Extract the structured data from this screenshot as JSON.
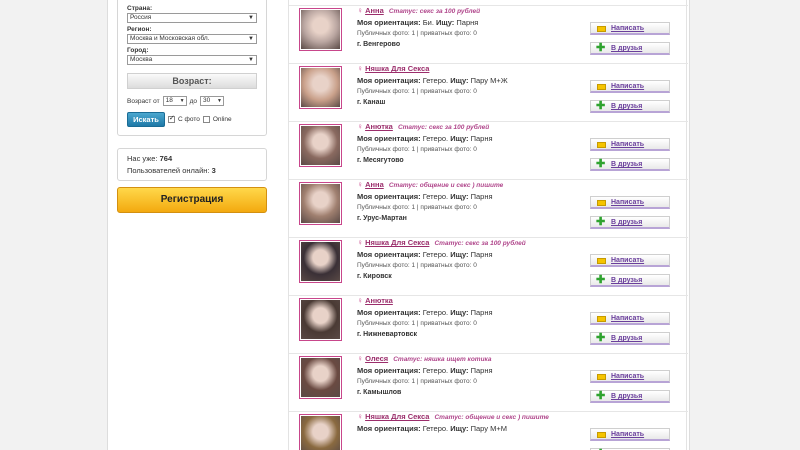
{
  "search": {
    "country_label": "Страна:",
    "country_value": "Россия",
    "region_label": "Регион:",
    "region_value": "Москва и Московская обл.",
    "city_label": "Город:",
    "city_value": "Москва",
    "age_title": "Возраст:",
    "age_from_label": "Возраст от",
    "age_from_value": "18",
    "age_to_label": "до",
    "age_to_value": "30",
    "search_button": "Искать",
    "with_photo_label": "С фото",
    "with_photo_checked": true,
    "online_label": "Online",
    "online_checked": false
  },
  "stats": {
    "total_label": "Нас уже:",
    "total_value": "764",
    "online_label": "Пользователей онлайн:",
    "online_value": "3"
  },
  "register_button": "Регистрация",
  "labels": {
    "orientation": "Моя ориентация:",
    "seeking": "Ищу:",
    "write_button": "Написать",
    "friends_button": "В друзья",
    "status_prefix": "Статус:"
  },
  "profiles": [
    {
      "name": "Анна",
      "status": "Статус: секс за 100 рублей",
      "orientation": "Би.",
      "seeking": "Парня",
      "photos": "Публичных фото: 1 | приватных фото: 0",
      "city": "г. Венгерово",
      "photo_color": "#b9a5a0"
    },
    {
      "name": "Няшка Для Секса",
      "status": "",
      "orientation": "Гетеро.",
      "seeking": "Пару М+Ж",
      "photos": "Публичных фото: 1 | приватных фото: 0",
      "city": "г. Канаш",
      "photo_color": "#c9a08a"
    },
    {
      "name": "Анютка",
      "status": "Статус: секс за 100 рублей",
      "orientation": "Гетеро.",
      "seeking": "Парня",
      "photos": "Публичных фото: 1 | приватных фото: 0",
      "city": "г. Месягутово",
      "photo_color": "#8a6a60"
    },
    {
      "name": "Анна",
      "status": "Статус: общение и секс ) пишите",
      "orientation": "Гетеро.",
      "seeking": "Парня",
      "photos": "Публичных фото: 1 | приватных фото: 0",
      "city": "г. Урус-Мартан",
      "photo_color": "#a08070"
    },
    {
      "name": "Няшка Для Секса",
      "status": "Статус: секс за 100 рублей",
      "orientation": "Гетеро.",
      "seeking": "Парня",
      "photos": "Публичных фото: 1 | приватных фото: 0",
      "city": "г. Кировск",
      "photo_color": "#3a3036"
    },
    {
      "name": "Анютка",
      "status": "",
      "orientation": "Гетеро.",
      "seeking": "Парня",
      "photos": "Публичных фото: 1 | приватных фото: 0",
      "city": "г. Нижневартовск",
      "photo_color": "#4a3a34"
    },
    {
      "name": "Олеся",
      "status": "Статус: няшка ищет котика",
      "orientation": "Гетеро.",
      "seeking": "Парня",
      "photos": "Публичных фото: 1 | приватных фото: 0",
      "city": "г. Камышлов",
      "photo_color": "#6a4a42"
    },
    {
      "name": "Няшка Для Секса",
      "status": "Статус: общение и секс ) пишите",
      "orientation": "Гетеро.",
      "seeking": "Пару М+М",
      "photos": "",
      "city": "",
      "photo_color": "#8a6a40"
    }
  ]
}
